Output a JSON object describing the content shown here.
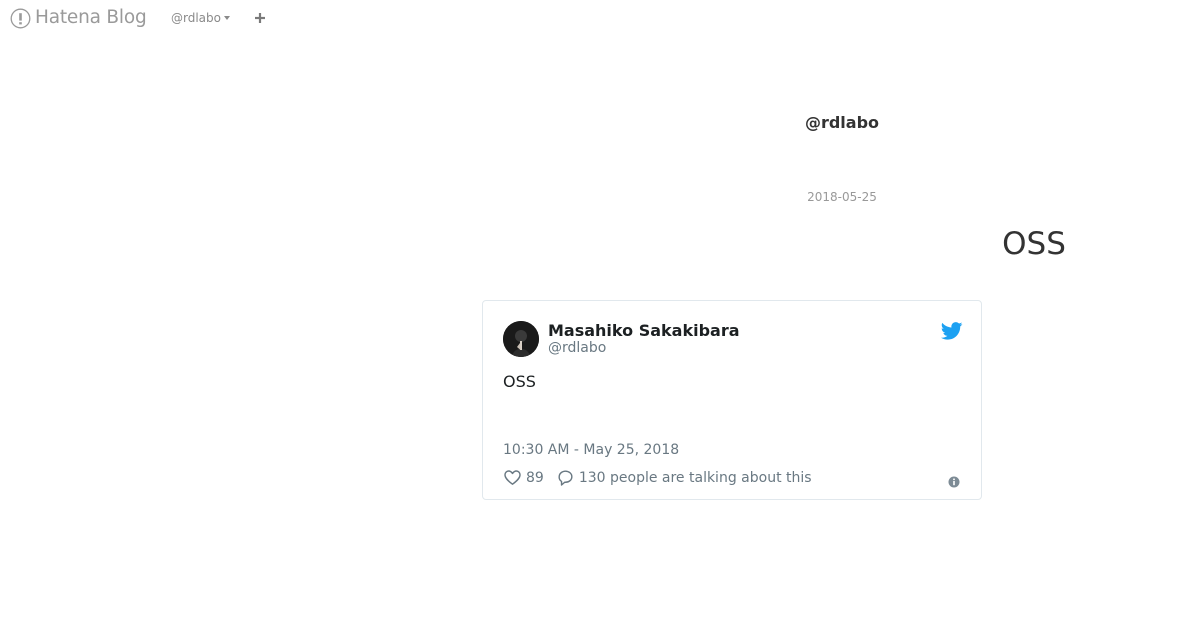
{
  "header": {
    "brand": "Hatena Blog",
    "user_menu_label": "@rdlabo",
    "logo_icon": "hatena-logo-icon",
    "plus_icon": "plus-icon"
  },
  "blog": {
    "title": "@rdlabo"
  },
  "entry": {
    "date": "2018-05-25",
    "title": "OSS"
  },
  "tweet": {
    "author_name": "Masahiko Sakakibara",
    "author_handle": "@rdlabo",
    "text": "OSS",
    "timestamp": "10:30 AM - May 25, 2018",
    "likes": "89",
    "talking": "130 people are talking about this",
    "icons": {
      "brand": "twitter-bird-icon",
      "like": "heart-icon",
      "reply": "reply-icon",
      "info": "info-icon"
    },
    "colors": {
      "twitter_blue": "#1da1f2",
      "meta_gray": "#697882",
      "border": "#e1e8ed"
    }
  }
}
